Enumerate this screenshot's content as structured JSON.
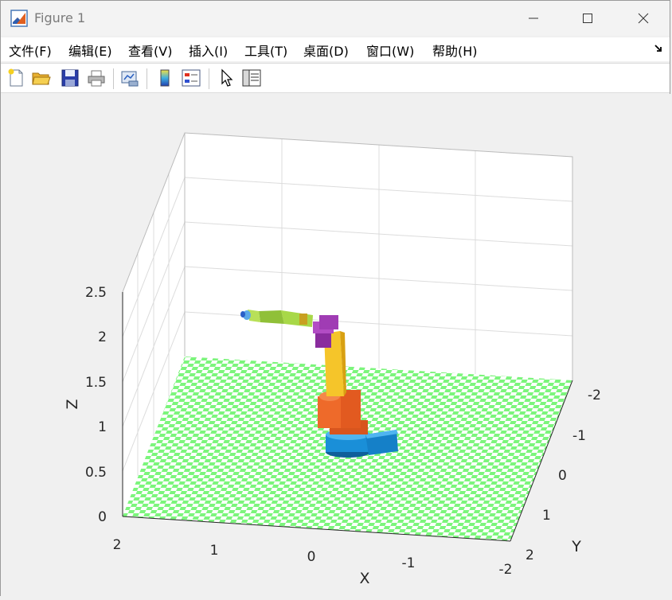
{
  "window": {
    "title": "Figure 1"
  },
  "menu": {
    "items": [
      "文件(F)",
      "编辑(E)",
      "查看(V)",
      "插入(I)",
      "工具(T)",
      "桌面(D)",
      "窗口(W)",
      "帮助(H)"
    ]
  },
  "toolbar": {
    "buttons": [
      "new-figure",
      "open-file",
      "save",
      "print",
      "link-plot",
      "insert-colorbar",
      "insert-legend",
      "edit-plot",
      "property-inspector"
    ]
  },
  "axes": {
    "xlabel": "X",
    "ylabel": "Y",
    "zlabel": "Z",
    "x_ticks": [
      "2",
      "1",
      "0",
      "-1",
      "-2"
    ],
    "y_ticks": [
      "-2",
      "-1",
      "0",
      "1",
      "2"
    ],
    "z_ticks": [
      "0",
      "0.5",
      "1",
      "1.5",
      "2",
      "2.5"
    ],
    "xlim": [
      -2,
      2
    ],
    "ylim": [
      -2,
      2
    ],
    "zlim": [
      0,
      2.5
    ],
    "grid": true
  },
  "colors": {
    "floor_green": "#7cf57c",
    "floor_white": "#ffffff",
    "base_blue": "#1a8fd8",
    "link_orange": "#ee6a2a",
    "link_yellow": "#f5c52a",
    "wrist_purple": "#a03cb4",
    "tool_green": "#a0d040"
  }
}
